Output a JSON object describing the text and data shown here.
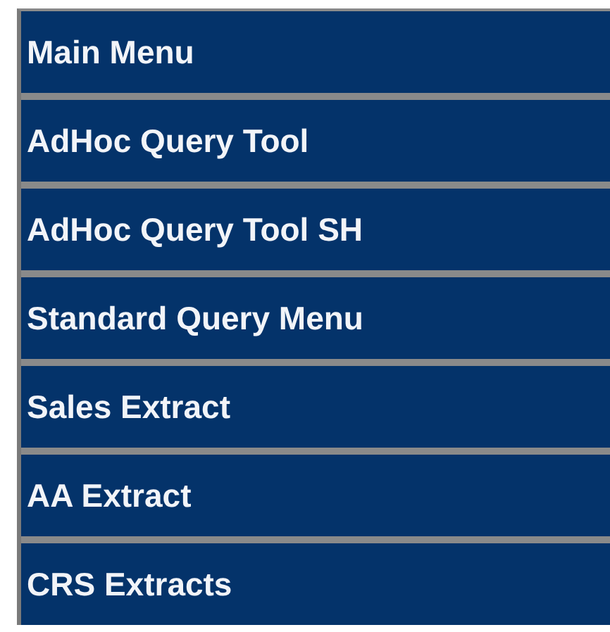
{
  "menu": {
    "items": [
      {
        "label": "Main Menu"
      },
      {
        "label": "AdHoc Query Tool"
      },
      {
        "label": "AdHoc Query Tool SH"
      },
      {
        "label": "Standard Query Menu"
      },
      {
        "label": "Sales Extract"
      },
      {
        "label": "AA Extract"
      },
      {
        "label": "CRS Extracts"
      }
    ]
  }
}
